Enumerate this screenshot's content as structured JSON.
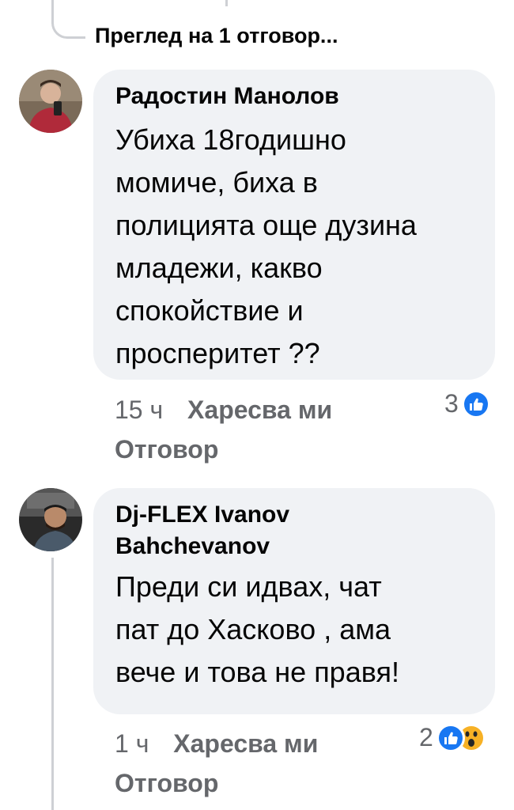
{
  "view_replies": "Преглед на 1 отговор...",
  "comments": [
    {
      "author": "Радостин Манолов",
      "text_lines": [
        "Убиха 18годишно",
        "момиче, биха в",
        "полицията още дузина",
        "младежи, какво",
        "спокойствие и",
        "просперитет ??"
      ],
      "time": "15 ч",
      "like_label": "Харесва ми",
      "reply_label": "Отговор",
      "reaction_count": "3",
      "reactions": [
        "like-icon"
      ]
    },
    {
      "author_lines": [
        "Dj-FLEX Ivanov",
        "Bahchevanov"
      ],
      "text_lines": [
        "Преди си идвах, чат",
        "пат до Хасково , ама",
        "вече и това не правя!"
      ],
      "time": "1 ч",
      "like_label": "Харесва ми",
      "reply_label": "Отговор",
      "reaction_count": "2",
      "reactions": [
        "like-icon",
        "wow-icon"
      ]
    }
  ],
  "colors": {
    "bubble": "#f0f2f5",
    "meta": "#65676b",
    "like": "#1877f2",
    "wow": "#f7b125"
  }
}
